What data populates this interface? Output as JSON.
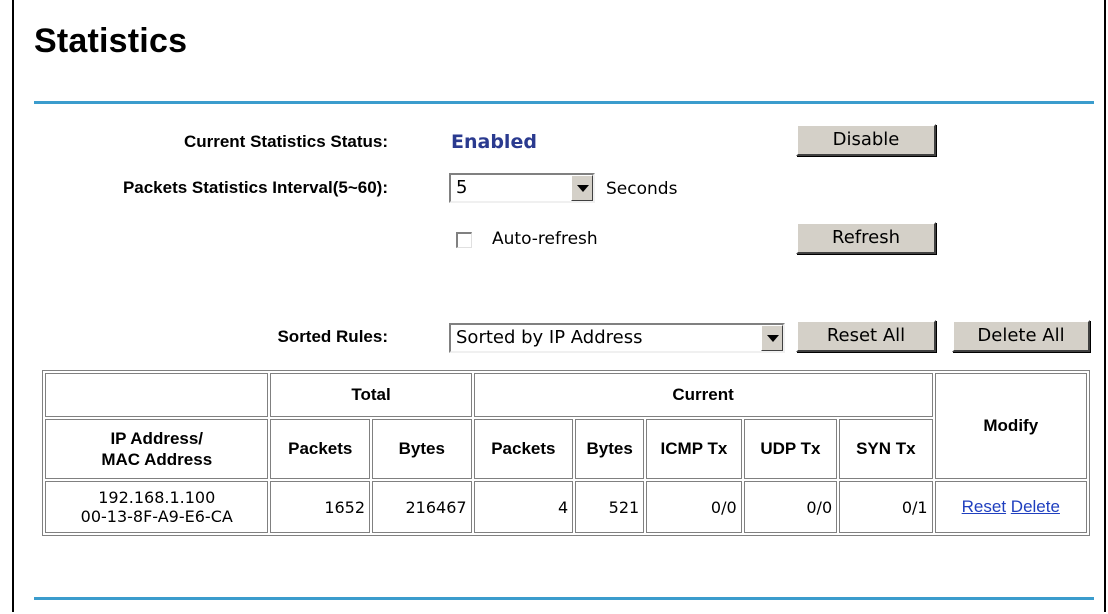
{
  "page": {
    "title": "Statistics"
  },
  "controls": {
    "status_label": "Current Statistics Status:",
    "status_value": "Enabled",
    "disable_label": "Disable",
    "interval_label": "Packets Statistics Interval(5~60):",
    "interval_value": "5",
    "seconds_label": "Seconds",
    "autorefresh_label": "Auto-refresh",
    "autorefresh_checked": false,
    "refresh_label": "Refresh",
    "sorted_rules_label": "Sorted Rules:",
    "sorted_rules_value": "Sorted by IP Address",
    "reset_all_label": "Reset All",
    "delete_all_label": "Delete All"
  },
  "table": {
    "group_headers": {
      "total": "Total",
      "current": "Current",
      "modify": "Modify"
    },
    "col_address_line1": "IP Address/",
    "col_address_line2": "MAC Address",
    "columns": [
      "Packets",
      "Bytes",
      "Packets",
      "Bytes",
      "ICMP Tx",
      "UDP Tx",
      "SYN Tx"
    ],
    "rows": [
      {
        "ip": "192.168.1.100",
        "mac": "00-13-8F-A9-E6-CA",
        "total_packets": "1652",
        "total_bytes": "216467",
        "current_packets": "4",
        "current_bytes": "521",
        "icmp_tx": "0/0",
        "udp_tx": "0/0",
        "syn_tx": "0/1",
        "reset_label": "Reset",
        "delete_label": "Delete"
      }
    ]
  },
  "colors": {
    "divider": "#3b9ccd",
    "status": "#2a3a8f",
    "link": "#1f3fbf",
    "button": "#d4d0c8"
  }
}
